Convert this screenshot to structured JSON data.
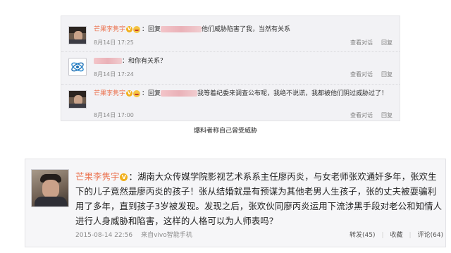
{
  "top_panel": {
    "comments": [
      {
        "username": "芒果李隽宇",
        "verified_badge": "V",
        "reply_prefix": "：回复",
        "text": "他们威胁陷害了我，当然有关系",
        "time": "8月14日 17:25",
        "actions": [
          "查看对话",
          "回复"
        ]
      },
      {
        "username": "",
        "text": "：和你有关系？",
        "time": "8月14日 17:24",
        "actions": [
          "查看对话",
          "回复"
        ]
      },
      {
        "username": "芒果李隽宇",
        "verified_badge": "V",
        "reply_prefix": "：回复",
        "text": "我等着纪委来调查公布呢，我绝不说谎，我都被他们阴过威胁过了！",
        "time": "8月14日 17:00",
        "actions": [
          "查看对话",
          "回复"
        ]
      }
    ]
  },
  "caption": "爆料者称自己曾受威胁",
  "post": {
    "username": "芒果李隽宇",
    "verified_badge": "V",
    "content": "：湖南大众传媒学院影视艺术系系主任廖丙炎，与女老师张欢通奸多年，张欢生下的儿子竟然是廖丙炎的孩子！张从结婚就是有预谋为其他老男人生孩子，张的丈夫被耍骗利用了多年，直到孩子3岁被发现。发现之后，张欢伙同廖丙炎运用下流涉黑手段对老公和知情人进行人身威胁和陷害，这样的人格可以为人师表吗？",
    "timestamp": "2015-08-14 22:56",
    "source": "来自vivo智能手机",
    "repost_label": "转发(45)",
    "favorite_label": "收藏",
    "comment_label": "评论(64)",
    "separator": "|"
  },
  "colors": {
    "username": "#eb7350",
    "verified_badge": "#f1b01c",
    "panel_bg": "#f2f2f5",
    "card_bg": "#f6f6f8"
  },
  "icons": {
    "avatar": "user-photo-avatar",
    "china-mobile": "china-mobile-logo-icon",
    "emoji": "smiley-icon",
    "verified": "verified-v-icon"
  }
}
